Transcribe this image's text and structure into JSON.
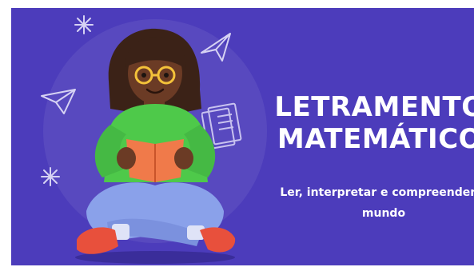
{
  "banner": {
    "title_line1": "LETRAMENTO",
    "title_line2": "MATEMÁTICO",
    "subtitle_line1": "Ler, interpretar e compreender o",
    "subtitle_line2": "mundo"
  },
  "colors": {
    "background": "#4c3cbb",
    "sweater": "#4ec94a",
    "pants": "#8aa1ea",
    "book": "#f07a4a",
    "shoes": "#e8503c"
  },
  "icons": [
    "sparkle-icon",
    "paper-plane-icon",
    "document-icon"
  ]
}
